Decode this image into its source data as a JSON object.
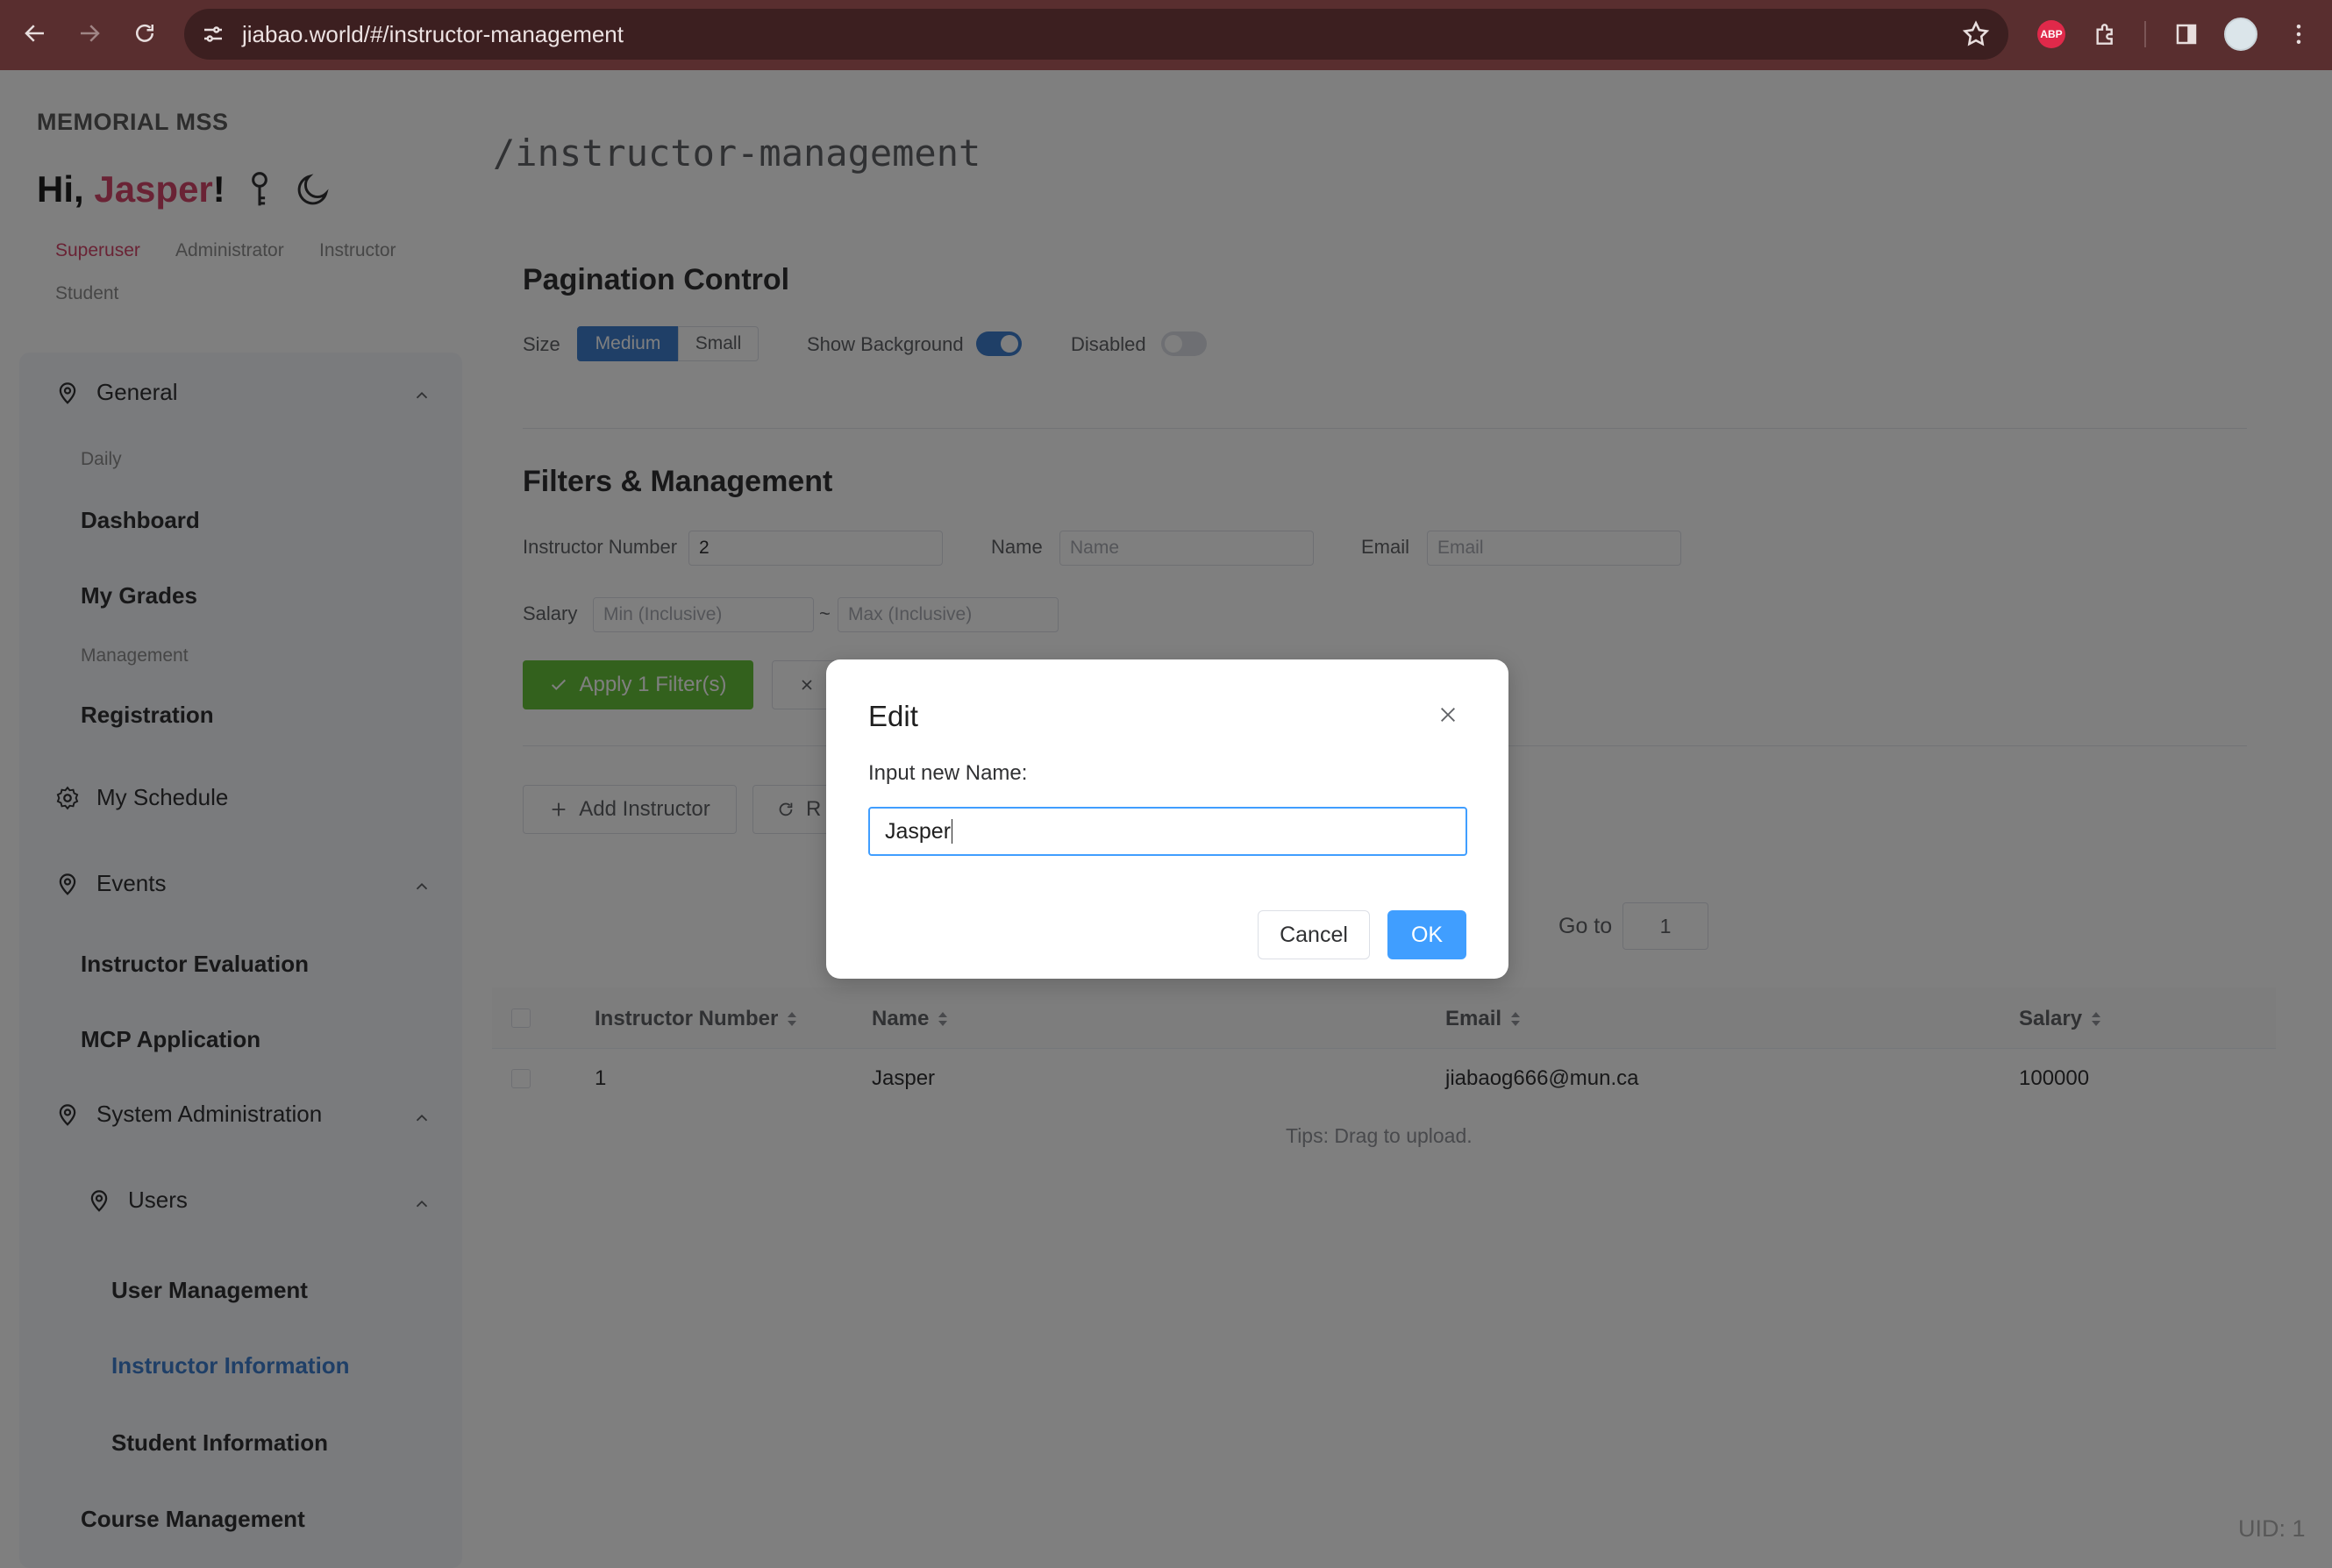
{
  "browser": {
    "url": "jiabao.world/#/instructor-management",
    "extension_badge": "ABP"
  },
  "sidebar": {
    "brand": "MEMORIAL MSS",
    "greeting_prefix": "Hi, ",
    "user_name": "Jasper",
    "greeting_suffix": "!",
    "roles": [
      "Superuser",
      "Administrator",
      "Instructor",
      "Student"
    ],
    "active_role": "Superuser",
    "menus": {
      "general": "General",
      "daily": "Daily",
      "dashboard": "Dashboard",
      "my_grades": "My Grades",
      "management": "Management",
      "registration": "Registration",
      "my_schedule": "My Schedule",
      "events": "Events",
      "instructor_evaluation": "Instructor Evaluation",
      "mcp_application": "MCP Application",
      "system_administration": "System Administration",
      "users": "Users",
      "user_management": "User Management",
      "instructor_information": "Instructor Information",
      "student_information": "Student Information",
      "course_management": "Course Management"
    },
    "active_item": "Instructor Information"
  },
  "main": {
    "route_title": "/instructor-management",
    "pagination_control": {
      "heading": "Pagination Control",
      "size_label": "Size",
      "size_options": [
        "Medium",
        "Small"
      ],
      "size_selected": "Medium",
      "show_background_label": "Show Background",
      "show_background": true,
      "disabled_label": "Disabled",
      "disabled": false
    },
    "filters": {
      "heading": "Filters & Management",
      "instructor_number_label": "Instructor Number",
      "instructor_number_value": "2",
      "name_label": "Name",
      "name_placeholder": "Name",
      "email_label": "Email",
      "email_placeholder": "Email",
      "salary_label": "Salary",
      "salary_min_placeholder": "Min (Inclusive)",
      "salary_separator": "~",
      "salary_max_placeholder": "Max (Inclusive)",
      "apply_button": "Apply 1 Filter(s)",
      "add_button": "Add Instructor",
      "refresh_button_partial": "R"
    },
    "goto_label": "Go to",
    "goto_value": "1",
    "table": {
      "columns": [
        "Instructor Number",
        "Name",
        "Email",
        "Salary"
      ],
      "rows": [
        {
          "instructor_number": "1",
          "name": "Jasper",
          "email": "jiabaog666@mun.ca",
          "salary": "100000"
        }
      ]
    },
    "tips": "Tips: Drag to upload.",
    "uid": "UID: 1"
  },
  "modal": {
    "title": "Edit",
    "label": "Input new Name:",
    "input_value": "Jasper",
    "cancel": "Cancel",
    "ok": "OK"
  },
  "colors": {
    "chrome": "#592e2f",
    "accent_blue": "#3f7fce",
    "apply_green": "#67c23a",
    "user_name": "#d4476a",
    "ok_button": "#409eff"
  }
}
